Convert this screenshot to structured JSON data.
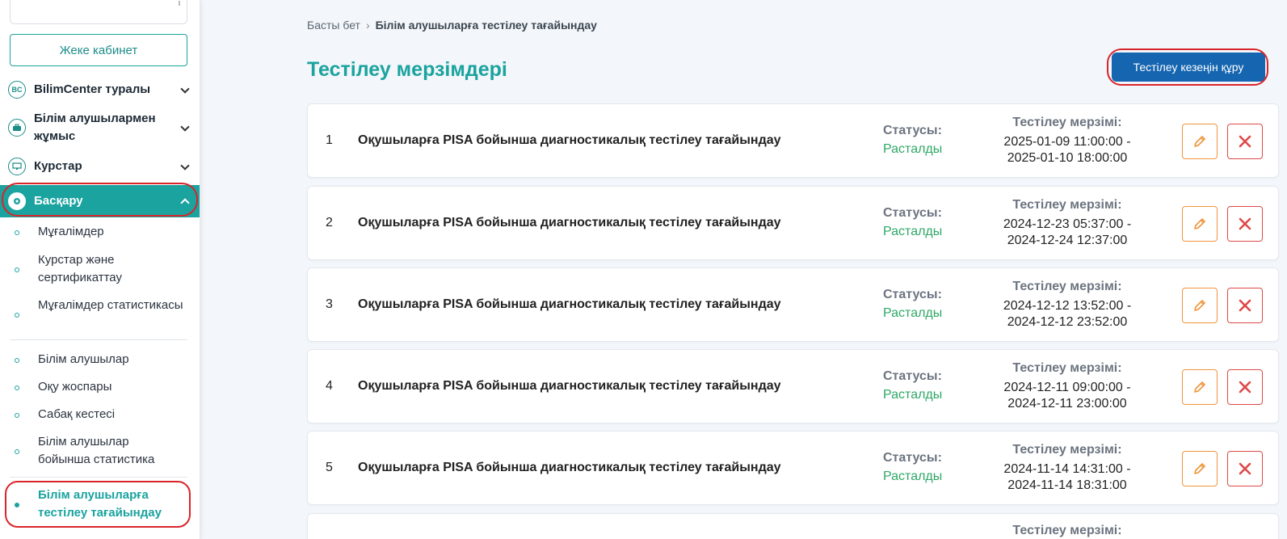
{
  "sidebar": {
    "cabinet_label": "Жеке кабинет",
    "nav": [
      {
        "label": "BilimCenter туралы",
        "icon": "bc-logo-icon",
        "icon_text": "BC"
      },
      {
        "label": "Білім алушылармен жұмыс",
        "icon": "briefcase-icon"
      },
      {
        "label": "Курстар",
        "icon": "monitor-icon"
      },
      {
        "label": "Басқару",
        "icon": "gear-icon"
      }
    ],
    "sub_items": [
      "Мұғалімдер",
      "Курстар және сертификаттау",
      "Мұғалімдер статистикасы",
      "Білім алушылар",
      "Оқу жоспары",
      "Сабақ кестесі",
      "Білім алушылар бойынша статистика",
      "Білім алушыларға тестілеу тағайындау"
    ]
  },
  "breadcrumb": {
    "home": "Басты бет",
    "current": "Білім алушыларға тестілеу тағайындау"
  },
  "page_title": "Тестілеу мерзімдері",
  "create_button": "Тестілеу кезеңін құру",
  "labels": {
    "status": "Статусы:",
    "period": "Тестілеу мерзімі:"
  },
  "rows": [
    {
      "num": "1",
      "title": "Оқушыларға PISA бойынша диагностикалық тестілеу тағайындау",
      "status": "Расталды",
      "start": "2025-01-09 11:00:00 -",
      "end": "2025-01-10 18:00:00"
    },
    {
      "num": "2",
      "title": "Оқушыларға PISA бойынша диагностикалық тестілеу тағайындау",
      "status": "Расталды",
      "start": "2024-12-23 05:37:00 -",
      "end": "2024-12-24 12:37:00"
    },
    {
      "num": "3",
      "title": "Оқушыларға PISA бойынша диагностикалық тестілеу тағайындау",
      "status": "Расталды",
      "start": "2024-12-12 13:52:00 -",
      "end": "2024-12-12 23:52:00"
    },
    {
      "num": "4",
      "title": "Оқушыларға PISA бойынша диагностикалық тестілеу тағайындау",
      "status": "Расталды",
      "start": "2024-12-11 09:00:00 -",
      "end": "2024-12-11 23:00:00"
    },
    {
      "num": "5",
      "title": "Оқушыларға PISA бойынша диагностикалық тестілеу тағайындау",
      "status": "Расталды",
      "start": "2024-11-14 14:31:00 -",
      "end": "2024-11-14 18:31:00"
    }
  ],
  "colors": {
    "accent": "#1aa39f",
    "primary_button": "#1565b0",
    "status_ok": "#2ea866",
    "edit": "#f0953a",
    "delete": "#e04848",
    "highlight_ring": "#d9252a"
  }
}
